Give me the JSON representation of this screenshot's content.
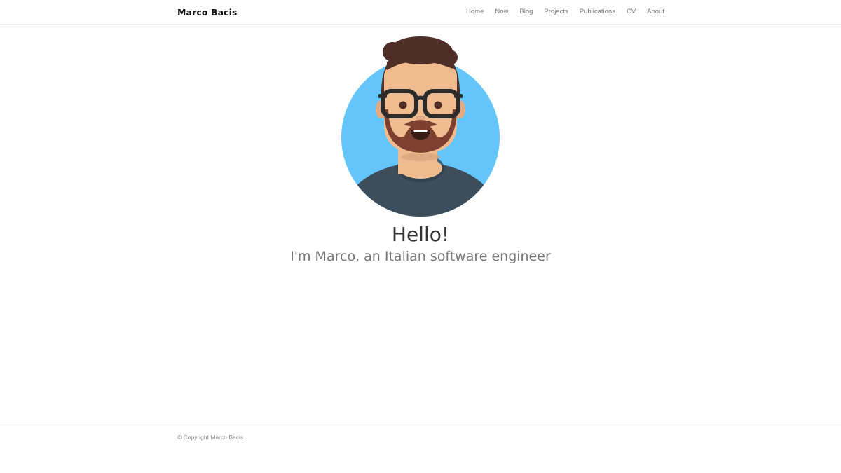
{
  "header": {
    "brand": "Marco Bacis",
    "nav": [
      {
        "label": "Home"
      },
      {
        "label": "Now"
      },
      {
        "label": "Blog"
      },
      {
        "label": "Projects"
      },
      {
        "label": "Publications"
      },
      {
        "label": "CV"
      },
      {
        "label": "About"
      }
    ]
  },
  "hero": {
    "title": "Hello!",
    "subtitle": "I'm Marco, an Italian software engineer",
    "avatar_icon": "bearded-man-glasses-avatar-icon"
  },
  "footer": {
    "copyright": "© Copyright Marco Bacis"
  },
  "colors": {
    "avatar_background": "#64c5fb",
    "shirt": "#3c4d5c",
    "skin": "#efbb8f",
    "hair": "#4e2e26",
    "beard": "#7d3f2f",
    "glasses": "#2b2b2b"
  }
}
